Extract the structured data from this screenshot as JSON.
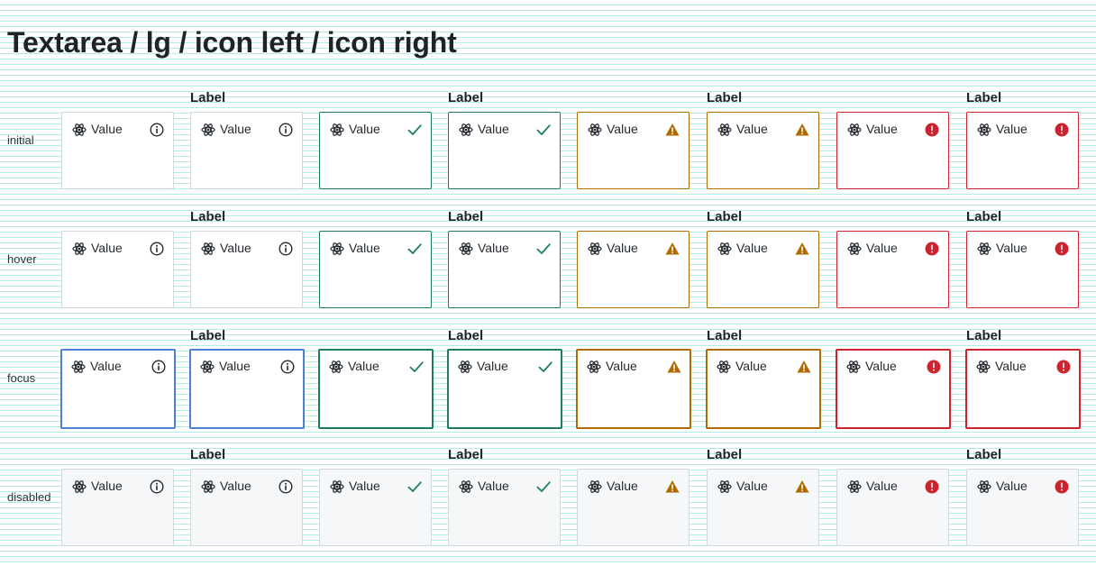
{
  "page": {
    "title": "Textarea / lg / icon left / icon right"
  },
  "field_label": "Label",
  "value": "Value",
  "rows": [
    {
      "state": "initial"
    },
    {
      "state": "hover"
    },
    {
      "state": "focus"
    },
    {
      "state": "disabled"
    }
  ],
  "columns": [
    {
      "status": "default",
      "labeled": false,
      "right_icon": "info-icon"
    },
    {
      "status": "default",
      "labeled": true,
      "right_icon": "info-icon"
    },
    {
      "status": "success",
      "labeled": false,
      "right_icon": "checkmark-icon"
    },
    {
      "status": "success",
      "labeled": true,
      "right_icon": "checkmark-icon"
    },
    {
      "status": "warning",
      "labeled": false,
      "right_icon": "warning-icon"
    },
    {
      "status": "warning",
      "labeled": true,
      "right_icon": "warning-icon"
    },
    {
      "status": "error",
      "labeled": false,
      "right_icon": "error-icon"
    },
    {
      "status": "error",
      "labeled": true,
      "right_icon": "error-icon"
    }
  ],
  "left_icon": "atom-icon",
  "colors": {
    "default_border": "#d0d7de",
    "focus_border": "#4a80d8",
    "success": "#1a7f5a",
    "warning": "#b06b00",
    "error": "#cf222e",
    "disabled_bg": "#f5f7f8",
    "grid_lines": "#b4ece4"
  }
}
